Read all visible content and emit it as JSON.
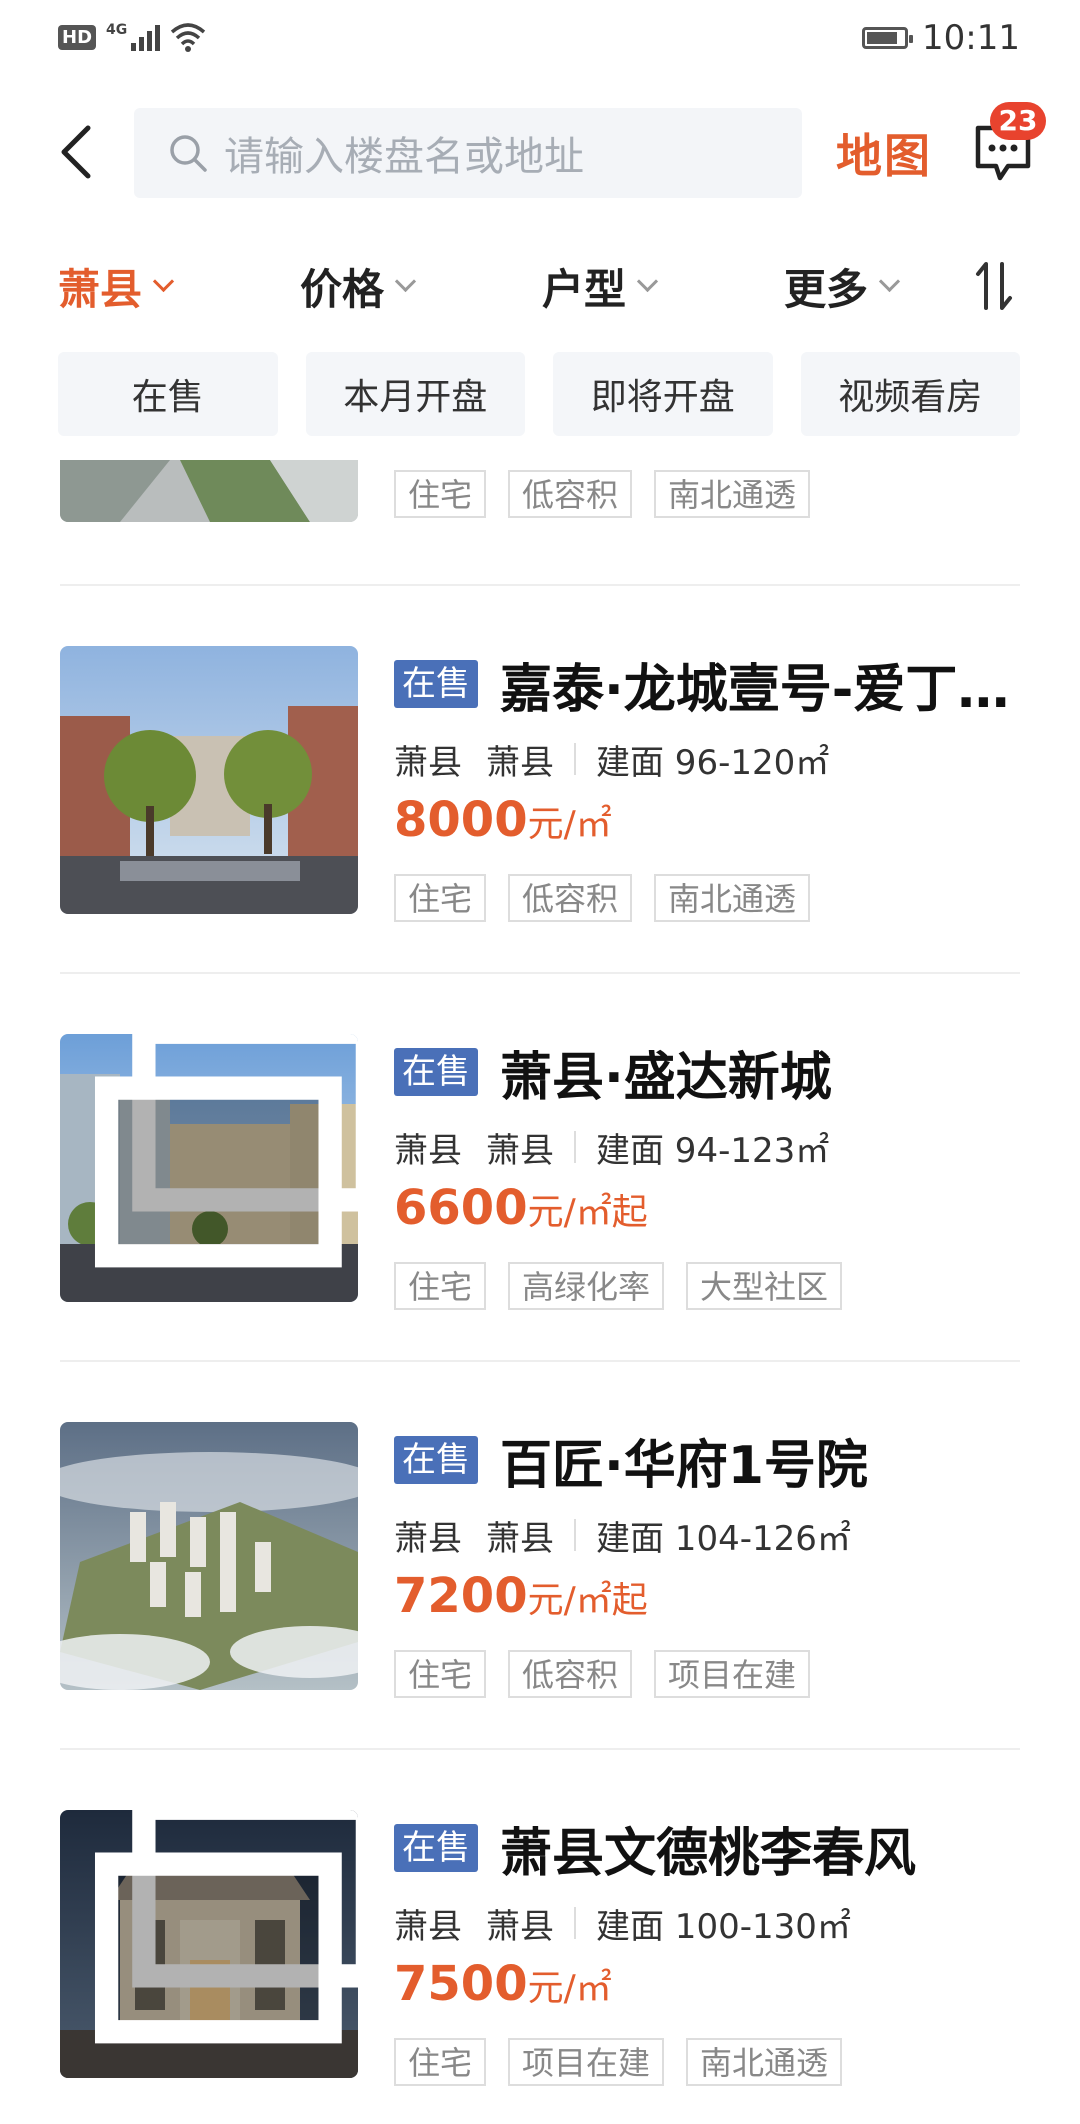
{
  "status_bar": {
    "hd": "HD",
    "network": "4G",
    "time": "10:11"
  },
  "header": {
    "search_placeholder": "请输入楼盘名或地址",
    "map_label": "地图",
    "message_badge": "23"
  },
  "filters": [
    {
      "label": "萧县",
      "active": true
    },
    {
      "label": "价格",
      "active": false
    },
    {
      "label": "户型",
      "active": false
    },
    {
      "label": "更多",
      "active": false
    }
  ],
  "chips": [
    "在售",
    "本月开盘",
    "即将开盘",
    "视频看房"
  ],
  "partial_item": {
    "tags": [
      "住宅",
      "低容积",
      "南北通透"
    ]
  },
  "listings": [
    {
      "status": "在售",
      "title": "嘉泰·龙城壹号-爱丁...",
      "district": "萧县",
      "area": "萧县",
      "size": "建面 96-120㎡",
      "price": "8000",
      "unit": "元/㎡",
      "tags": [
        "住宅",
        "低容积",
        "南北通透"
      ],
      "has_video": false
    },
    {
      "status": "在售",
      "title": "萧县·盛达新城",
      "district": "萧县",
      "area": "萧县",
      "size": "建面 94-123㎡",
      "price": "6600",
      "unit": "元/㎡起",
      "tags": [
        "住宅",
        "高绿化率",
        "大型社区"
      ],
      "has_video": true
    },
    {
      "status": "在售",
      "title": "百匠·华府1号院",
      "district": "萧县",
      "area": "萧县",
      "size": "建面 104-126㎡",
      "price": "7200",
      "unit": "元/㎡起",
      "tags": [
        "住宅",
        "低容积",
        "项目在建"
      ],
      "has_video": false
    },
    {
      "status": "在售",
      "title": "萧县文德桃李春风",
      "district": "萧县",
      "area": "萧县",
      "size": "建面 100-130㎡",
      "price": "7500",
      "unit": "元/㎡",
      "tags": [
        "住宅",
        "项目在建",
        "南北通透"
      ],
      "has_video": true
    }
  ],
  "colors": {
    "accent": "#e35d2d",
    "status_badge": "#4a70b8",
    "badge_red": "#e8432e"
  }
}
